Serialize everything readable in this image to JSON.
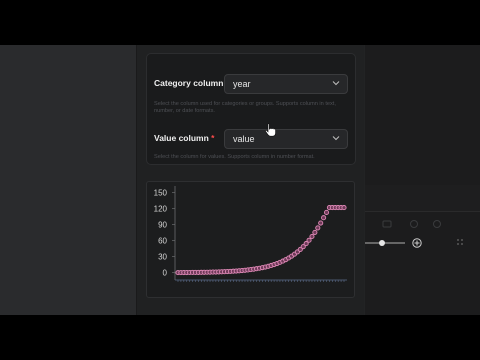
{
  "form": {
    "category": {
      "label": "Category column",
      "required_mark": "*",
      "value": "year",
      "help": "Select the column used for categories or groups. Supports column in text, number, or date formats."
    },
    "value_field": {
      "label": "Value column",
      "required_mark": "*",
      "value": "value",
      "help": "Select the column for values. Supports column in number format."
    }
  },
  "chart_data": {
    "type": "scatter",
    "title": "",
    "xlabel": "",
    "ylabel": "",
    "ylim": [
      -10,
      155
    ],
    "yticks": [
      "150",
      "120",
      "90",
      "60",
      "30",
      "0"
    ],
    "ytick_values": [
      150,
      120,
      90,
      60,
      30,
      0
    ],
    "point_color": "#e08ab8",
    "x": [
      1,
      2,
      3,
      4,
      5,
      6,
      7,
      8,
      9,
      10,
      11,
      12,
      13,
      14,
      15,
      16,
      17,
      18,
      19,
      20,
      21,
      22,
      23,
      24,
      25,
      26,
      27,
      28,
      29,
      30,
      31,
      32,
      33,
      34,
      35,
      36,
      37,
      38,
      39,
      40,
      41,
      42,
      43,
      44,
      45,
      46,
      47,
      48,
      49,
      50,
      51,
      52,
      53,
      54,
      55,
      56,
      57,
      58
    ],
    "values": [
      0.1,
      0.1,
      0.2,
      0.2,
      0.3,
      0.4,
      0.4,
      0.5,
      0.6,
      0.7,
      0.8,
      0.9,
      1.1,
      1.2,
      1.4,
      1.6,
      1.8,
      2.1,
      2.4,
      2.7,
      3.1,
      3.5,
      4.0,
      4.5,
      5.1,
      5.8,
      6.5,
      7.4,
      8.3,
      9.4,
      10.6,
      12.0,
      13.5,
      15.2,
      17.1,
      19.3,
      21.7,
      24.4,
      27.5,
      30.9,
      34.7,
      38.9,
      43.6,
      48.8,
      54.5,
      60.8,
      67.8,
      75.5,
      83.9,
      93.1,
      103.0,
      113.0,
      122.0,
      122.0,
      122.0,
      122.0,
      122.0,
      122.0
    ]
  },
  "colors": {
    "accent_required": "#ff4b4b",
    "chart_points": "#e08ab8"
  }
}
